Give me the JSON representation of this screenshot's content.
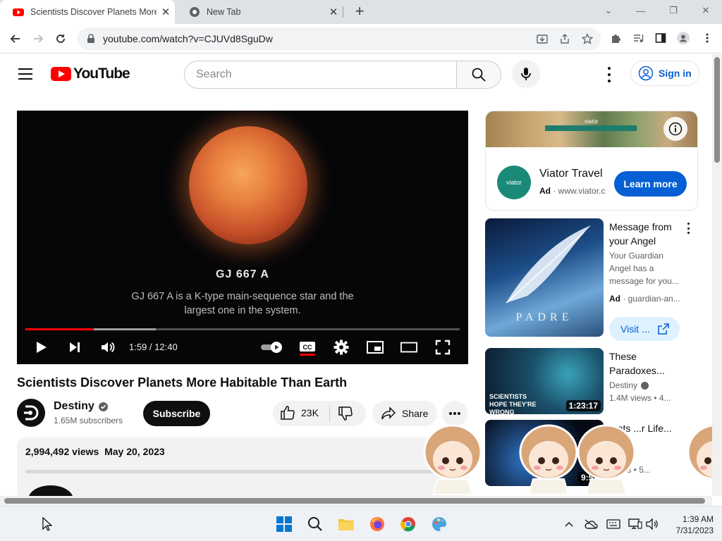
{
  "browser": {
    "tabs": [
      {
        "title": "Scientists Discover Planets More",
        "active": true
      },
      {
        "title": "New Tab",
        "active": false
      }
    ],
    "url": "youtube.com/watch?v=CJUVd8SguDw"
  },
  "header": {
    "logo_text": "YouTube",
    "search_placeholder": "Search",
    "signin_label": "Sign in"
  },
  "player": {
    "caption_title": "GJ 667 A",
    "caption_body": "GJ 667 A is a K-type main-sequence star and the largest one in the system.",
    "time": "1:59 / 12:40",
    "played_fraction": 0.157,
    "buffered_fraction": 0.3
  },
  "video": {
    "title": "Scientists Discover Planets More Habitable Than Earth",
    "channel": "Destiny",
    "subscribers": "1.65M subscribers",
    "subscribe_label": "Subscribe",
    "likes": "23K",
    "share_label": "Share",
    "views": "2,994,492 views",
    "date": "May 20, 2023"
  },
  "ad": {
    "name": "Viator Travel",
    "ad_label": "Ad",
    "domain": "www.viator.com",
    "cta": "Learn more",
    "logo_text": "viator"
  },
  "related": [
    {
      "title": "Message from your Angel",
      "channel": "Your Guardian Angel has a message for you...",
      "ad_label": "Ad",
      "ad_domain": "guardian-an...",
      "cta": "Visit ...",
      "thumb_text": "PADRE"
    },
    {
      "title": "These Paradoxes...",
      "channel": "Destiny",
      "meta": "1.4M views  •  4...",
      "duration": "1:23:17",
      "thumb_text": "SCIENTISTS HOPE THEY'RE WRONG"
    },
    {
      "title": "...ets ...r Life...",
      "channel": "",
      "meta": "...ews  •  5...",
      "duration": "9:52"
    }
  ],
  "taskbar": {
    "time": "1:39 AM",
    "date": "7/31/2023"
  }
}
